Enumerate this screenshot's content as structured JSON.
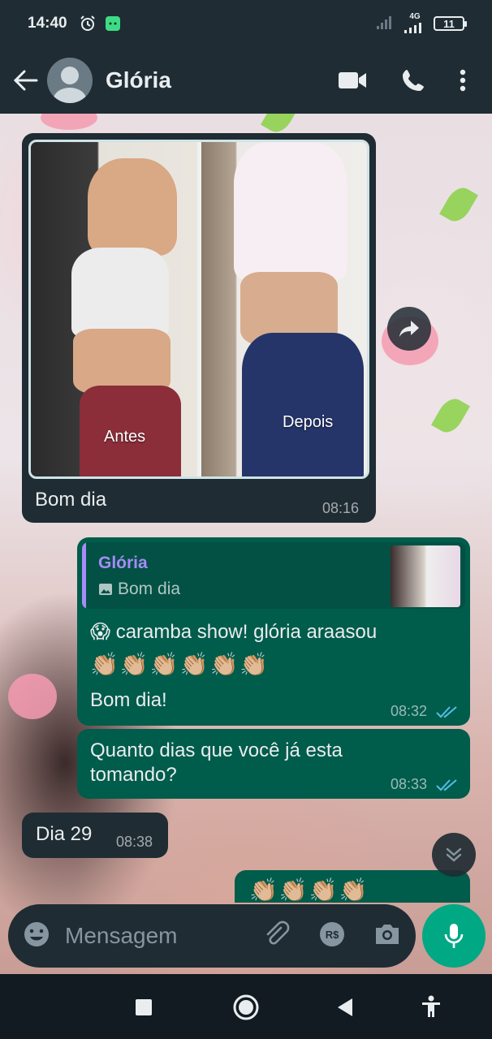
{
  "status_bar": {
    "time": "14:40",
    "network": "4G",
    "battery": "11"
  },
  "header": {
    "contact_name": "Glória"
  },
  "messages": {
    "photo": {
      "label_before": "Antes",
      "label_after": "Depois",
      "caption": "Bom dia",
      "time": "08:16"
    },
    "reply": {
      "quoted_name": "Glória",
      "quoted_text": "Bom dia",
      "line1": "😱 caramba show!  glória araasou",
      "emoji_row": "👏🏼👏🏼👏🏼👏🏼👏🏼👏🏼",
      "line3": "Bom dia!",
      "time": "08:32"
    },
    "question": {
      "text_line1": "Quanto dias que você já  esta",
      "text_line2": "tomando?",
      "time": "08:33"
    },
    "answer": {
      "text": "Dia 29",
      "time": "08:38"
    },
    "partial": {
      "emoji_row": "👏🏼👏🏼👏🏼👏🏼"
    }
  },
  "input": {
    "placeholder": "Mensagem"
  },
  "colors": {
    "incoming_bubble": "#202c33",
    "outgoing_bubble": "#005c4b",
    "accent": "#00a884",
    "quote_name": "#a78bfa",
    "read_ticks": "#53bdeb"
  }
}
